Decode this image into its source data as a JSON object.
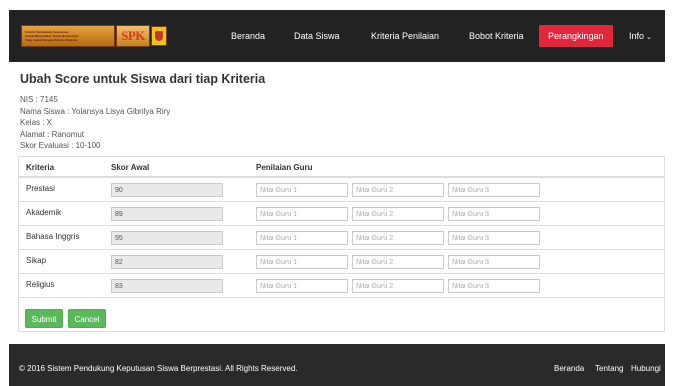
{
  "navbar": {
    "logo": {
      "text_lines": [
        "Sistem Pendukung Keputusan",
        "Untuk Menentukan Siswa Berprestasi",
        "Yang Layak Dengan Kriteria Tertentu"
      ],
      "badge": "SPK"
    },
    "items": [
      {
        "label": "Beranda"
      },
      {
        "label": "Data Siswa"
      },
      {
        "label": "Kriteria Penilaian"
      },
      {
        "label": "Bobot Kriteria"
      },
      {
        "label": "Perangkingan"
      },
      {
        "label": "Info"
      }
    ],
    "active_color": "#e3263a"
  },
  "page": {
    "title": "Ubah Score untuk Siswa dari tiap Kriteria",
    "info": {
      "nis": "NIS : 7145",
      "nama": "Nama Siswa : Yolansya Lisya Gibrilya Riry",
      "kelas": "Kelas : X",
      "alamat": "Alamat : Ranomut",
      "skor": "Skor Evaluasi : 10-100"
    }
  },
  "table": {
    "headers": {
      "kriteria": "Kriteria",
      "skor_awal": "Skor Awal",
      "penilaian": "Penilaian Guru"
    },
    "placeholders": {
      "guru1": "Nilai Guru 1",
      "guru2": "Nilai Guru 2",
      "guru3": "Nilai Guru 3"
    },
    "rows": [
      {
        "kriteria": "Prestasi",
        "skor": "90"
      },
      {
        "kriteria": "Akademik",
        "skor": "89"
      },
      {
        "kriteria": "Bahasa Inggris",
        "skor": "95"
      },
      {
        "kriteria": "Sikap",
        "skor": "82"
      },
      {
        "kriteria": "Religius",
        "skor": "83"
      }
    ]
  },
  "buttons": {
    "submit": "Submit",
    "cancel": "Cancel",
    "color": "#5cb85c"
  },
  "footer": {
    "copyright": "© 2016 Sistem Pendukung Keputusan Siswa Berprestasi. All Rights Reserved.",
    "links": [
      {
        "label": "Beranda"
      },
      {
        "label": "Tentang"
      },
      {
        "label": "Hubungi"
      }
    ]
  }
}
